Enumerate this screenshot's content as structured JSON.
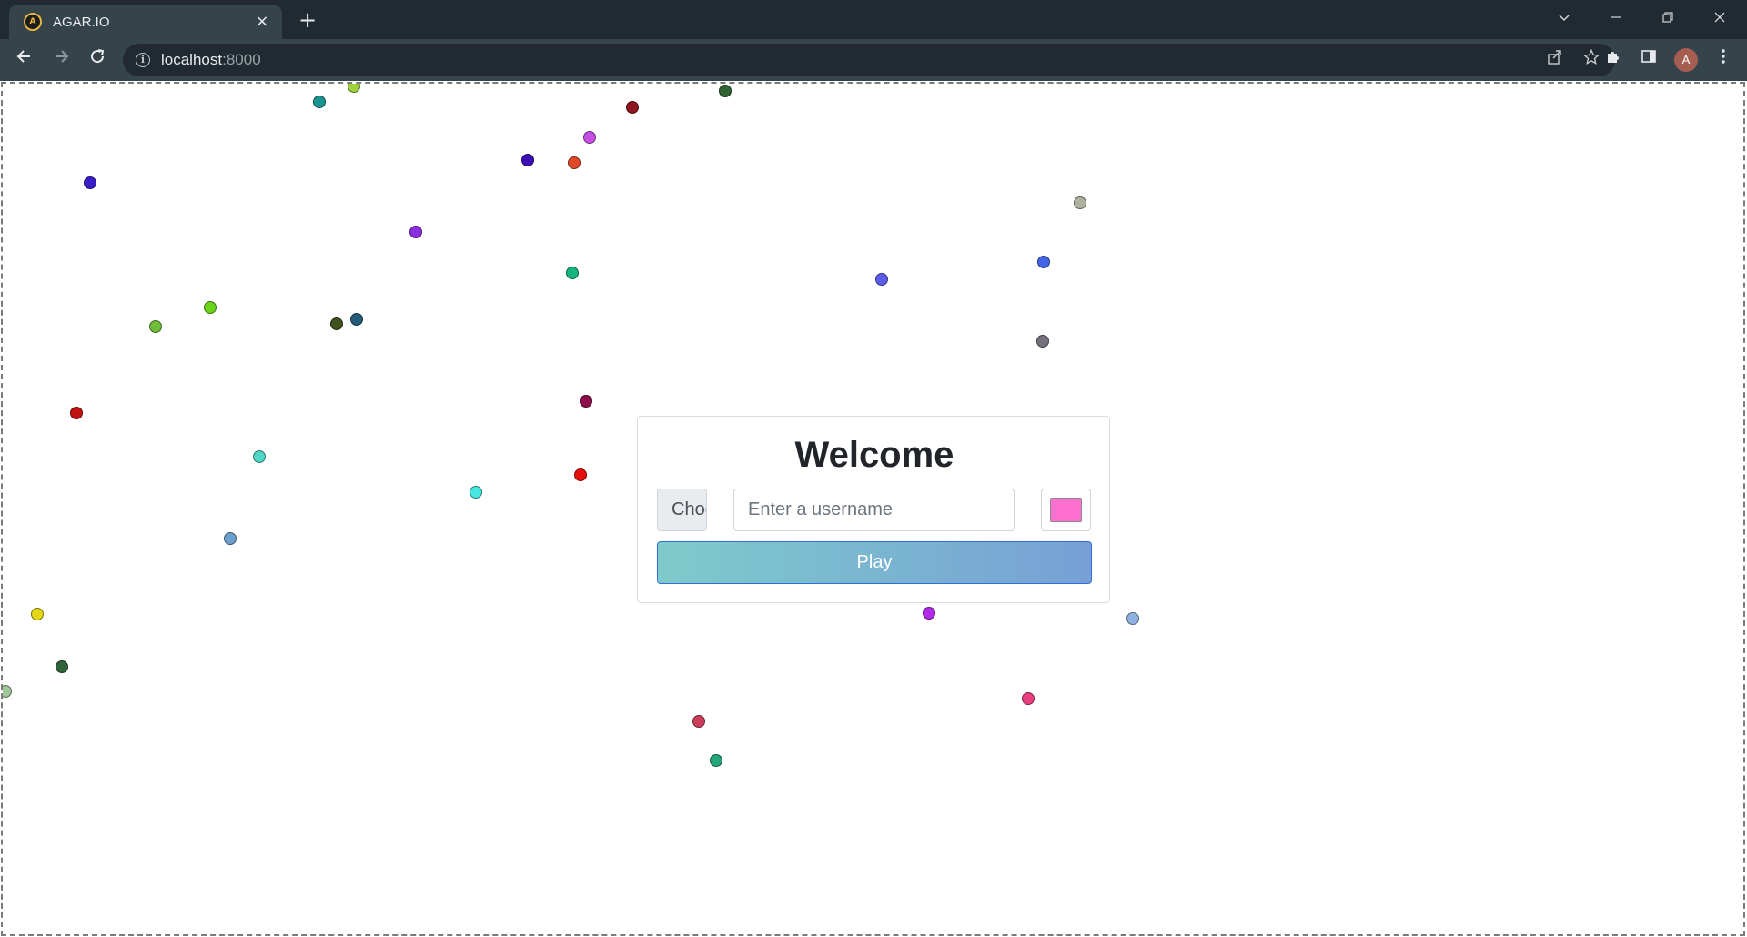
{
  "browser": {
    "tab_title": "AGAR.IO",
    "favicon_text": "A",
    "close_tab_glyph": "×",
    "new_tab_glyph": "+",
    "url_host": "localhost",
    "url_port": ":8000",
    "profile_initial": "A",
    "icons": {
      "back": "back-arrow-icon",
      "forward": "forward-arrow-icon",
      "reload": "reload-icon",
      "site_info": "info-icon",
      "share": "share-icon",
      "bookmark": "star-icon",
      "extensions": "puzzle-icon",
      "side_panel": "side-panel-icon",
      "menu": "kebab-menu-icon",
      "tab_search": "chevron-down-icon",
      "minimize": "minimize-icon",
      "restore": "restore-icon",
      "close": "close-icon"
    }
  },
  "welcome": {
    "title": "Welcome",
    "skin_select_value": "Choose a skin",
    "username_placeholder": "Enter a username",
    "username_value": "",
    "selected_color": "#ff6fd0",
    "play_label": "Play"
  },
  "food_colors": [
    "#1b9591",
    "#9ed13b",
    "#8e1620",
    "#2f6331",
    "#c64fe3",
    "#3c0db3",
    "#e04a2a",
    "#3a1fc8",
    "#b0b0a0",
    "#8a2fe0",
    "#16b381",
    "#5b5ce8",
    "#4466e6",
    "#6bd31a",
    "#70bd3c",
    "#3f5220",
    "#245b78",
    "#767080",
    "#c01010",
    "#8f0c4c",
    "#52d6c6",
    "#e80f0f",
    "#48e6e0",
    "#6b9fcd",
    "#b6f08f",
    "#e4d816",
    "#b12be8",
    "#8fb3e0",
    "#30633a",
    "#a0c79a",
    "#e83f7f",
    "#cb3e5a",
    "#24a57a"
  ]
}
